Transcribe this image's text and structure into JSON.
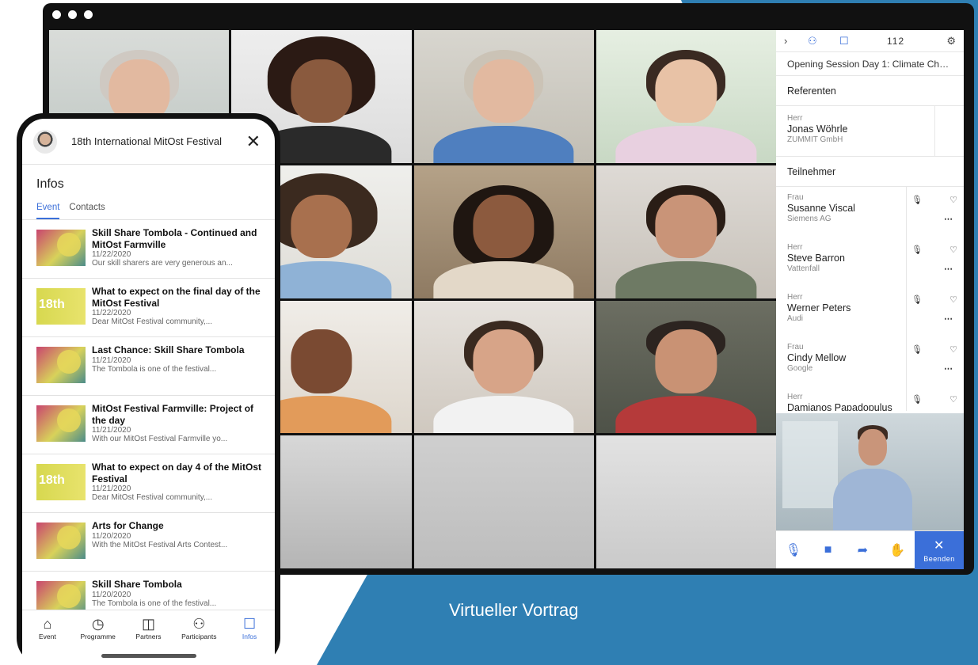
{
  "panel": {
    "participant_count": "112",
    "session_title": "Opening Session Day 1: Climate Chan...",
    "speakers_heading": "Referenten",
    "speakers": [
      {
        "salutation": "Herr",
        "name": "Jonas Wöhrle",
        "company": "ZUMMIT GmbH"
      }
    ],
    "participants_heading": "Teilnehmer",
    "participants": [
      {
        "salutation": "Frau",
        "name": "Susanne Viscal",
        "company": "Siemens AG"
      },
      {
        "salutation": "Herr",
        "name": "Steve Barron",
        "company": "Vattenfall"
      },
      {
        "salutation": "Herr",
        "name": "Werner Peters",
        "company": "Audi"
      },
      {
        "salutation": "Frau",
        "name": "Cindy Mellow",
        "company": "Google"
      },
      {
        "salutation": "Herr",
        "name": "Damianos Papadopulus",
        "company": ""
      }
    ],
    "end_label": "Beenden"
  },
  "caption": "Virtueller Vortrag",
  "phone": {
    "title": "18th International MitOst Festival",
    "section": "Infos",
    "tabs": [
      "Event",
      "Contacts"
    ],
    "items": [
      {
        "title": "Skill Share Tombola - Continued and MitOst Farmville",
        "date": "11/22/2020",
        "excerpt": "Our skill sharers are very generous an..."
      },
      {
        "title": "What to expect on the final day of the MitOst Festival",
        "date": "11/22/2020",
        "excerpt": "Dear MitOst Festival community,..."
      },
      {
        "title": "Last Chance: Skill Share Tombola",
        "date": "11/21/2020",
        "excerpt": "The Tombola is one of the festival..."
      },
      {
        "title": "MitOst Festival Farmville: Project of the day",
        "date": "11/21/2020",
        "excerpt": "With our MitOst Festival Farmville yo..."
      },
      {
        "title": "What to expect on day 4 of the MitOst Festival",
        "date": "11/21/2020",
        "excerpt": "Dear MitOst Festival community,..."
      },
      {
        "title": "Arts for Change",
        "date": "11/20/2020",
        "excerpt": "With the MitOst Festival Arts Contest..."
      },
      {
        "title": "Skill Share Tombola",
        "date": "11/20/2020",
        "excerpt": "The Tombola is one of the festival..."
      }
    ],
    "thumb_text": "18th",
    "nav": [
      "Event",
      "Programme",
      "Partners",
      "Participants",
      "Infos"
    ]
  },
  "colors": {
    "accent": "#3b6fd9",
    "background_blue": "#2f7fb3"
  }
}
